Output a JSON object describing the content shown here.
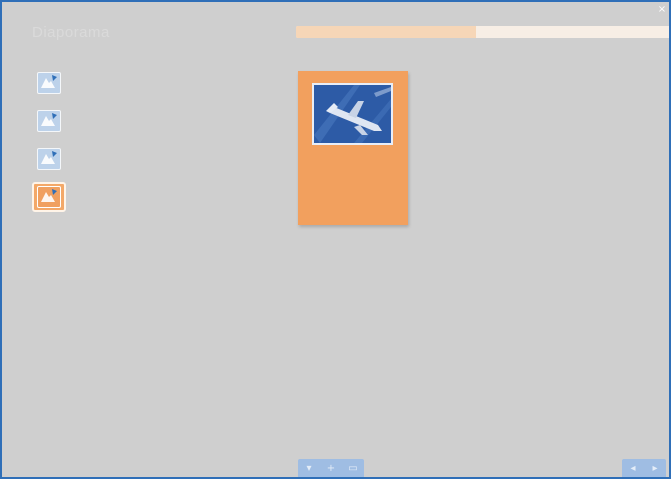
{
  "window": {
    "title": "Diaporama",
    "close_glyph": "×"
  },
  "progress": {
    "value": 0.48
  },
  "tools": [
    {
      "icon": "slide-edit-icon",
      "selected": false
    },
    {
      "icon": "slide-edit-icon",
      "selected": false
    },
    {
      "icon": "slide-edit-icon",
      "selected": false
    },
    {
      "icon": "slide-edit-icon",
      "selected": true
    }
  ],
  "slide": {
    "image": "airplane-photo"
  },
  "bottom_center": [
    {
      "icon": "save-icon",
      "glyph": "▾"
    },
    {
      "icon": "add-icon",
      "glyph": "+"
    },
    {
      "icon": "grid-icon",
      "glyph": "▭"
    }
  ],
  "bottom_right": [
    {
      "icon": "previous-icon",
      "glyph": "◂"
    },
    {
      "icon": "next-icon",
      "glyph": "▸"
    }
  ],
  "colors": {
    "accent": "#f2a05e",
    "frame_border": "#2f6fb8",
    "background": "#cfcfcf"
  }
}
